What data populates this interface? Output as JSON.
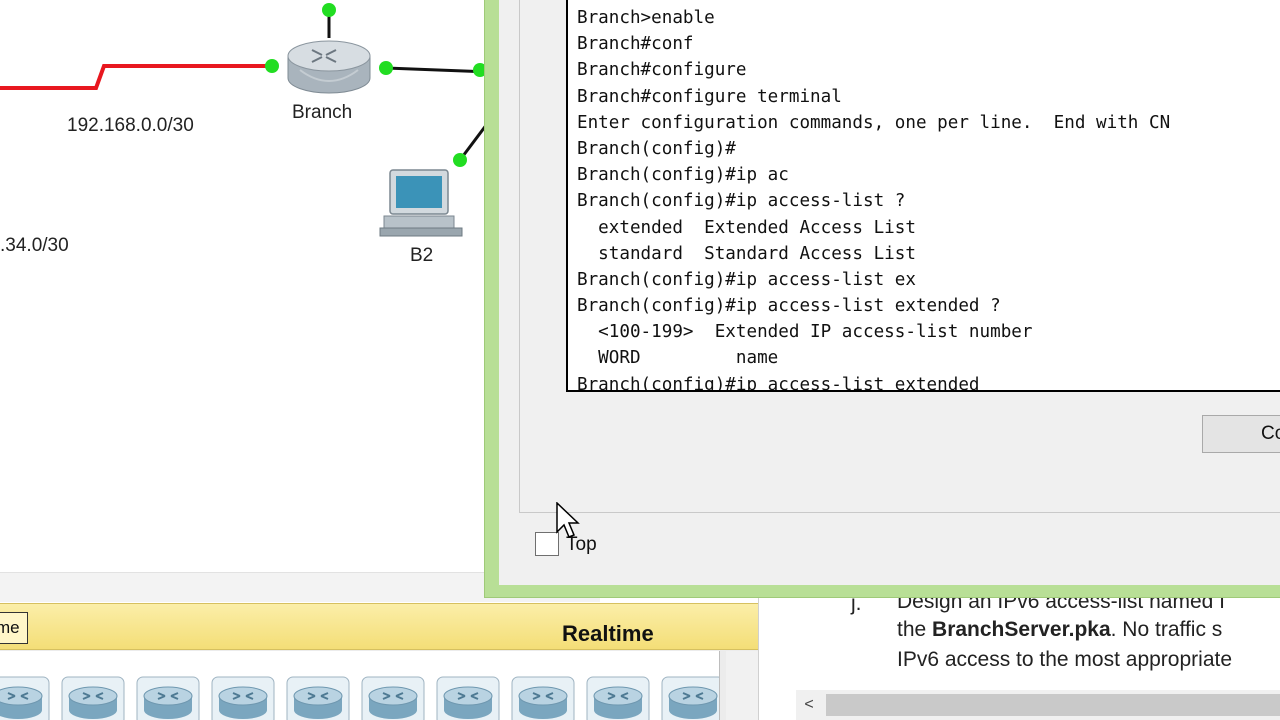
{
  "topology": {
    "network_labels": [
      "192.168.0.0/30",
      ".34.0/30"
    ],
    "devices": [
      {
        "label": "Branch",
        "type": "router-icon"
      },
      {
        "label": "B2",
        "type": "pc-icon"
      }
    ],
    "colors": {
      "serial_link": "#e8171f",
      "ethernet_link": "#111111",
      "link_up": "#22dd22"
    }
  },
  "cli": {
    "lines": [
      "Branch>enable",
      "Branch#conf",
      "Branch#configure",
      "Branch#configure terminal",
      "Enter configuration commands, one per line.  End with CN",
      "Branch(config)#",
      "Branch(config)#ip ac",
      "Branch(config)#ip access-list ?",
      "  extended  Extended Access List",
      "  standard  Standard Access List",
      "Branch(config)#ip access-list ex",
      "Branch(config)#ip access-list extended ?",
      "  <100-199>  Extended IP access-list number",
      "  WORD         name",
      "Branch(config)#ip access-list extended"
    ],
    "copy_label": "Copy",
    "top_label": "Top",
    "top_checked": false,
    "frame_color": "#b8df96"
  },
  "panel": {
    "time_tab_label": "me",
    "mode_label": "Realtime",
    "device_count": 10
  },
  "instructions": {
    "step": "j.",
    "line1": "Design an IPv6 access-list named I",
    "line2_prefix": "the ",
    "line2_bold": "BranchServer.pka",
    "line2_suffix": ". No traffic s",
    "line3": "IPv6 access to the most appropriate",
    "scroll_left": "<"
  }
}
